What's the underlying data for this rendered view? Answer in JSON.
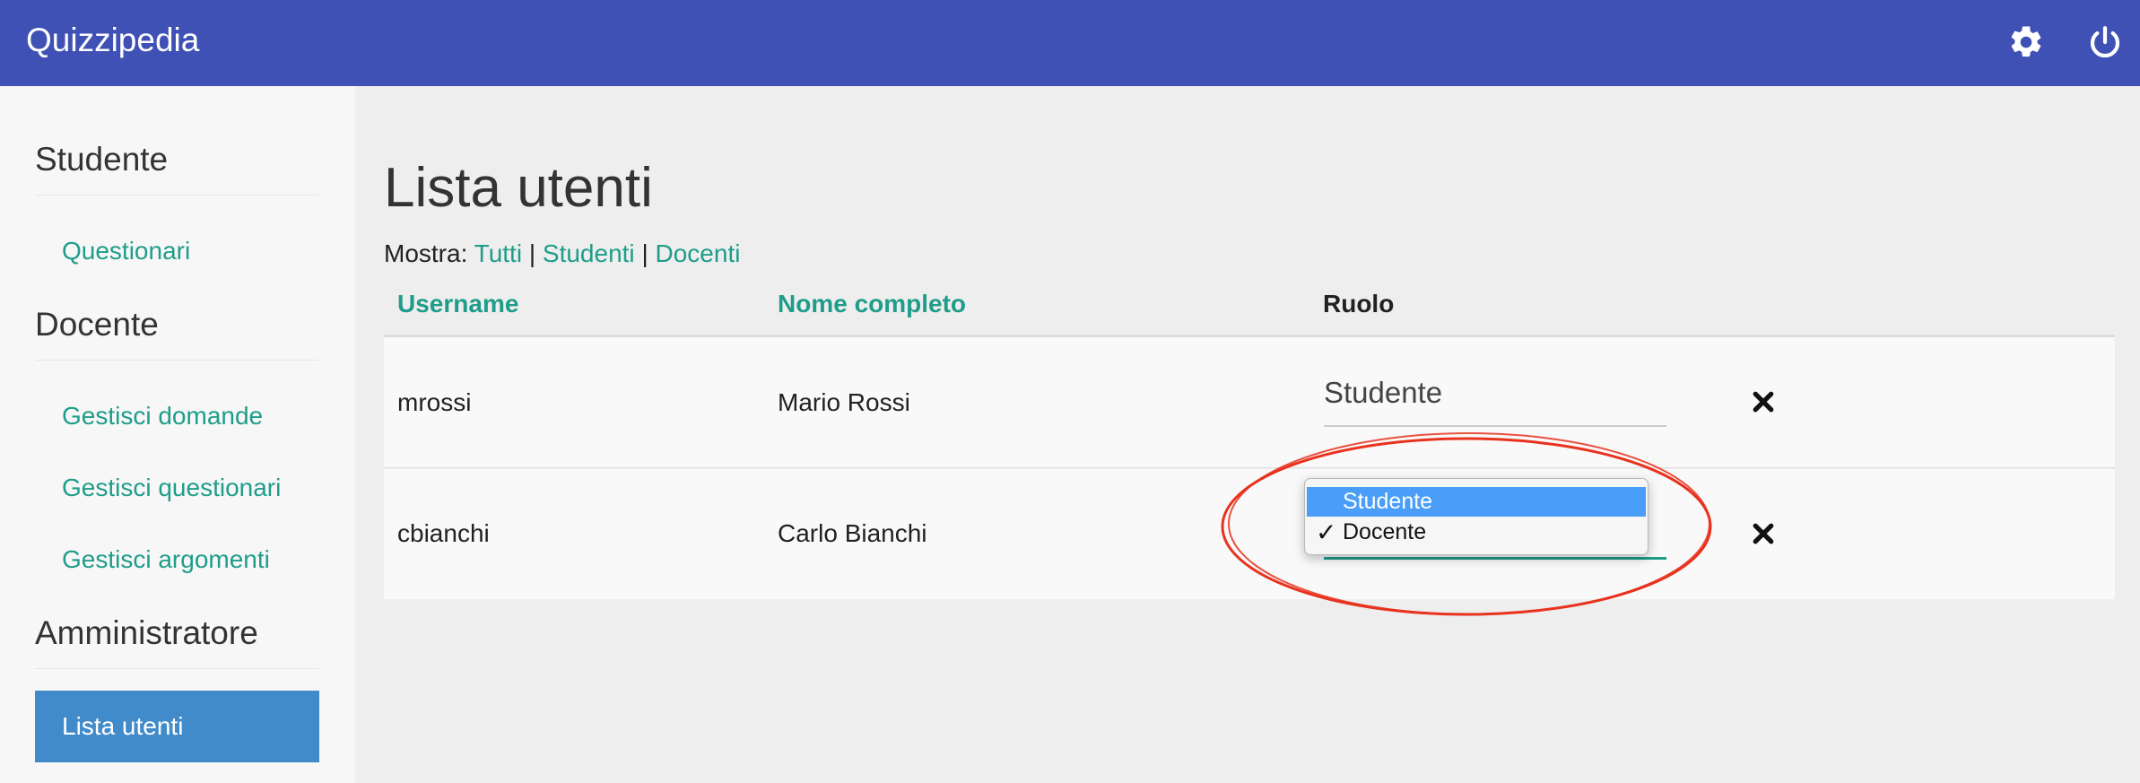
{
  "app": {
    "title": "Quizzipedia"
  },
  "header": {
    "icons": [
      "gear-icon",
      "power-icon"
    ]
  },
  "sidebar": {
    "sections": [
      {
        "title": "Studente",
        "items": [
          "Questionari"
        ]
      },
      {
        "title": "Docente",
        "items": [
          "Gestisci domande",
          "Gestisci questionari",
          "Gestisci argomenti"
        ]
      },
      {
        "title": "Amministratore",
        "items": [
          "Lista utenti"
        ]
      }
    ],
    "active_item": "Lista utenti"
  },
  "main": {
    "title": "Lista utenti",
    "filter": {
      "label": "Mostra:",
      "options": [
        "Tutti",
        "Studenti",
        "Docenti"
      ],
      "separator": "|"
    },
    "table": {
      "columns": [
        "Username",
        "Nome completo",
        "Ruolo"
      ],
      "rows": [
        {
          "username": "mrossi",
          "full_name": "Mario Rossi",
          "role": "Studente"
        },
        {
          "username": "cbianchi",
          "full_name": "Carlo Bianchi",
          "role": "Docente"
        }
      ]
    },
    "role_dropdown": {
      "options": [
        "Studente",
        "Docente"
      ],
      "highlighted": "Studente",
      "checked": "Docente",
      "check_glyph": "✓"
    }
  },
  "colors": {
    "navbar": "#3f51b5",
    "link": "#1f9d8a",
    "active": "#428bca",
    "highlight": "#4a9ef7",
    "annotation": "#e8321e"
  }
}
